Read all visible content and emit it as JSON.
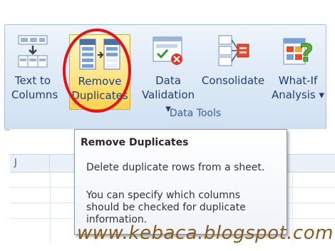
{
  "ribbon": {
    "buttons": [
      {
        "line1": "Text to",
        "line2": "Columns"
      },
      {
        "line1": "Remove",
        "line2": "Duplicates"
      },
      {
        "line1": "Data",
        "line2": "Validation",
        "dropdown": "▾"
      },
      {
        "line1": "Consolidate",
        "line2": ""
      },
      {
        "line1": "What-If",
        "line2": "Analysis",
        "dropdown": "▾"
      }
    ],
    "group_label": "Data Tools"
  },
  "sheet": {
    "column_headers": [
      "J",
      "",
      "",
      "",
      "",
      "",
      ""
    ]
  },
  "tooltip": {
    "title": "Remove Duplicates",
    "description": "Delete duplicate rows from a sheet.",
    "extra_line1": "You can specify which columns",
    "extra_line2": "should be checked for duplicate",
    "extra_line3": "information."
  },
  "watermark": "www.kebaca.blogspot.com",
  "colors": {
    "highlight_circle": "#e0141b",
    "ribbon_text": "#1f3f73",
    "watermark": "#8a5a1e"
  },
  "icons": [
    "text-to-columns-icon",
    "remove-duplicates-icon",
    "data-validation-icon",
    "consolidate-icon",
    "what-if-analysis-icon"
  ]
}
